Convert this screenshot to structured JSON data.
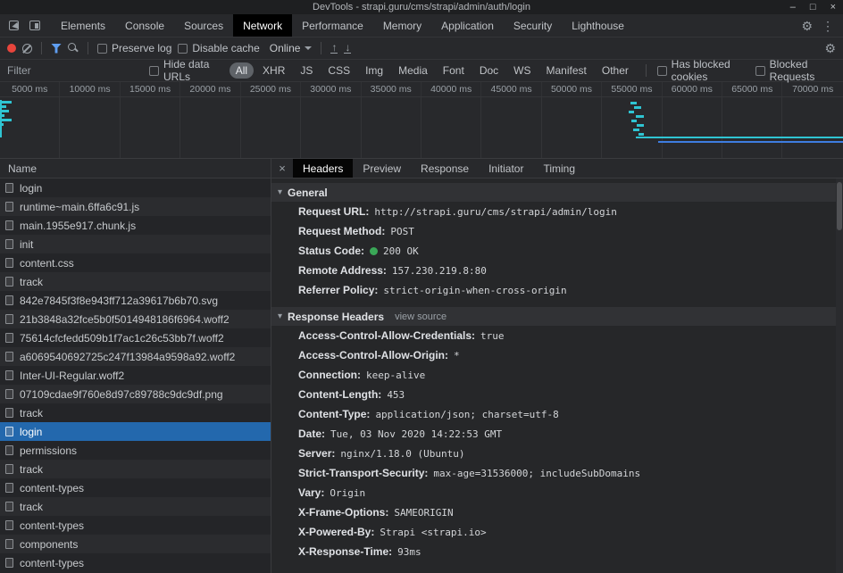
{
  "titlebar": {
    "title": "DevTools - strapi.guru/cms/strapi/admin/auth/login",
    "controls": {
      "minimize": "–",
      "maximize": "□",
      "close": "×"
    }
  },
  "main_tabs": {
    "items": [
      "Elements",
      "Console",
      "Sources",
      "Network",
      "Performance",
      "Memory",
      "Application",
      "Security",
      "Lighthouse"
    ],
    "selected": "Network"
  },
  "net_toolbar": {
    "preserve_log_label": "Preserve log",
    "disable_cache_label": "Disable cache",
    "throttle_value": "Online",
    "import_icon": "↑",
    "export_icon": "↓",
    "gear_icon": "⚙",
    "kebab_icon": "⋮"
  },
  "filter_bar": {
    "filter_placeholder": "Filter",
    "hide_data_urls_label": "Hide data URLs",
    "pills": [
      "All",
      "XHR",
      "JS",
      "CSS",
      "Img",
      "Media",
      "Font",
      "Doc",
      "WS",
      "Manifest",
      "Other"
    ],
    "selected_pill": "All",
    "has_blocked_cookies_label": "Has blocked cookies",
    "blocked_requests_label": "Blocked Requests"
  },
  "timeline": {
    "labels": [
      "5000 ms",
      "10000 ms",
      "15000 ms",
      "20000 ms",
      "25000 ms",
      "30000 ms",
      "35000 ms",
      "40000 ms",
      "45000 ms",
      "50000 ms",
      "55000 ms",
      "60000 ms",
      "65000 ms",
      "70000 ms"
    ]
  },
  "request_list": {
    "column_header": "Name",
    "selected_index": 13,
    "items": [
      "login",
      "runtime~main.6ffa6c91.js",
      "main.1955e917.chunk.js",
      "init",
      "content.css",
      "track",
      "842e7845f3f8e943ff712a39617b6b70.svg",
      "21b3848a32fce5b0f5014948186f6964.woff2",
      "75614cfcfedd509b1f7ac1c26c53bb7f.woff2",
      "a6069540692725c247f13984a9598a92.woff2",
      "Inter-UI-Regular.woff2",
      "07109cdae9f760e8d97c89788c9dc9df.png",
      "track",
      "login",
      "permissions",
      "track",
      "content-types",
      "track",
      "content-types",
      "components",
      "content-types"
    ]
  },
  "details": {
    "close_icon": "×",
    "tabs": [
      "Headers",
      "Preview",
      "Response",
      "Initiator",
      "Timing"
    ],
    "selected_tab": "Headers",
    "general": {
      "title": "General",
      "rows": [
        {
          "name": "Request URL:",
          "value": "http://strapi.guru/cms/strapi/admin/login"
        },
        {
          "name": "Request Method:",
          "value": "POST"
        },
        {
          "name": "Status Code:",
          "value": "200 OK",
          "status_dot_color": "#3aa757"
        },
        {
          "name": "Remote Address:",
          "value": "157.230.219.8:80"
        },
        {
          "name": "Referrer Policy:",
          "value": "strict-origin-when-cross-origin"
        }
      ]
    },
    "response_headers": {
      "title": "Response Headers",
      "view_source_label": "view source",
      "rows": [
        {
          "name": "Access-Control-Allow-Credentials:",
          "value": "true"
        },
        {
          "name": "Access-Control-Allow-Origin:",
          "value": "*"
        },
        {
          "name": "Connection:",
          "value": "keep-alive"
        },
        {
          "name": "Content-Length:",
          "value": "453"
        },
        {
          "name": "Content-Type:",
          "value": "application/json; charset=utf-8"
        },
        {
          "name": "Date:",
          "value": "Tue, 03 Nov 2020 14:22:53 GMT"
        },
        {
          "name": "Server:",
          "value": "nginx/1.18.0 (Ubuntu)"
        },
        {
          "name": "Strict-Transport-Security:",
          "value": "max-age=31536000; includeSubDomains"
        },
        {
          "name": "Vary:",
          "value": "Origin"
        },
        {
          "name": "X-Frame-Options:",
          "value": "SAMEORIGIN"
        },
        {
          "name": "X-Powered-By:",
          "value": "Strapi <strapi.io>"
        },
        {
          "name": "X-Response-Time:",
          "value": "93ms"
        }
      ]
    }
  },
  "colors": {
    "selected_row_blue": "#2368ad",
    "waterfall_teal": "#2fc4d2",
    "waterfall_blue": "#3e7de0",
    "record_red": "#e8453c",
    "status_green": "#3aa757",
    "filter_active_blue": "#5f9ef0"
  }
}
